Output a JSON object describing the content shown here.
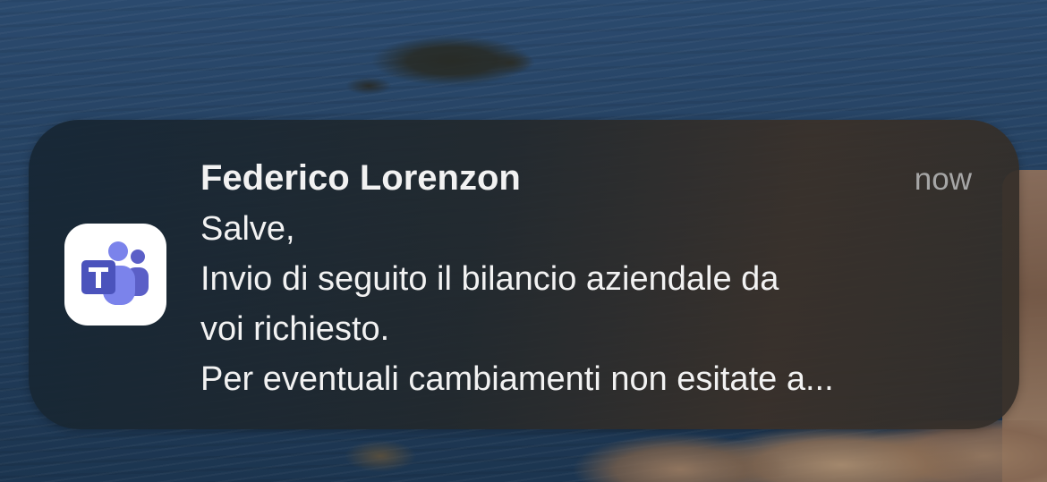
{
  "background": {
    "type": "wallpaper",
    "description_icon": "sea-and-rocks-wallpaper"
  },
  "notification": {
    "app_icon": "microsoft-teams-icon",
    "sender": "Federico Lorenzon",
    "time": "now",
    "message_lines": [
      "Salve,",
      "Invio di seguito il bilancio aziendale da",
      "voi richiesto.",
      "Per eventuali cambiamenti non esitate a..."
    ]
  },
  "colors": {
    "teams_purple": "#5b5fc7",
    "teams_purple_light": "#7b83eb"
  }
}
